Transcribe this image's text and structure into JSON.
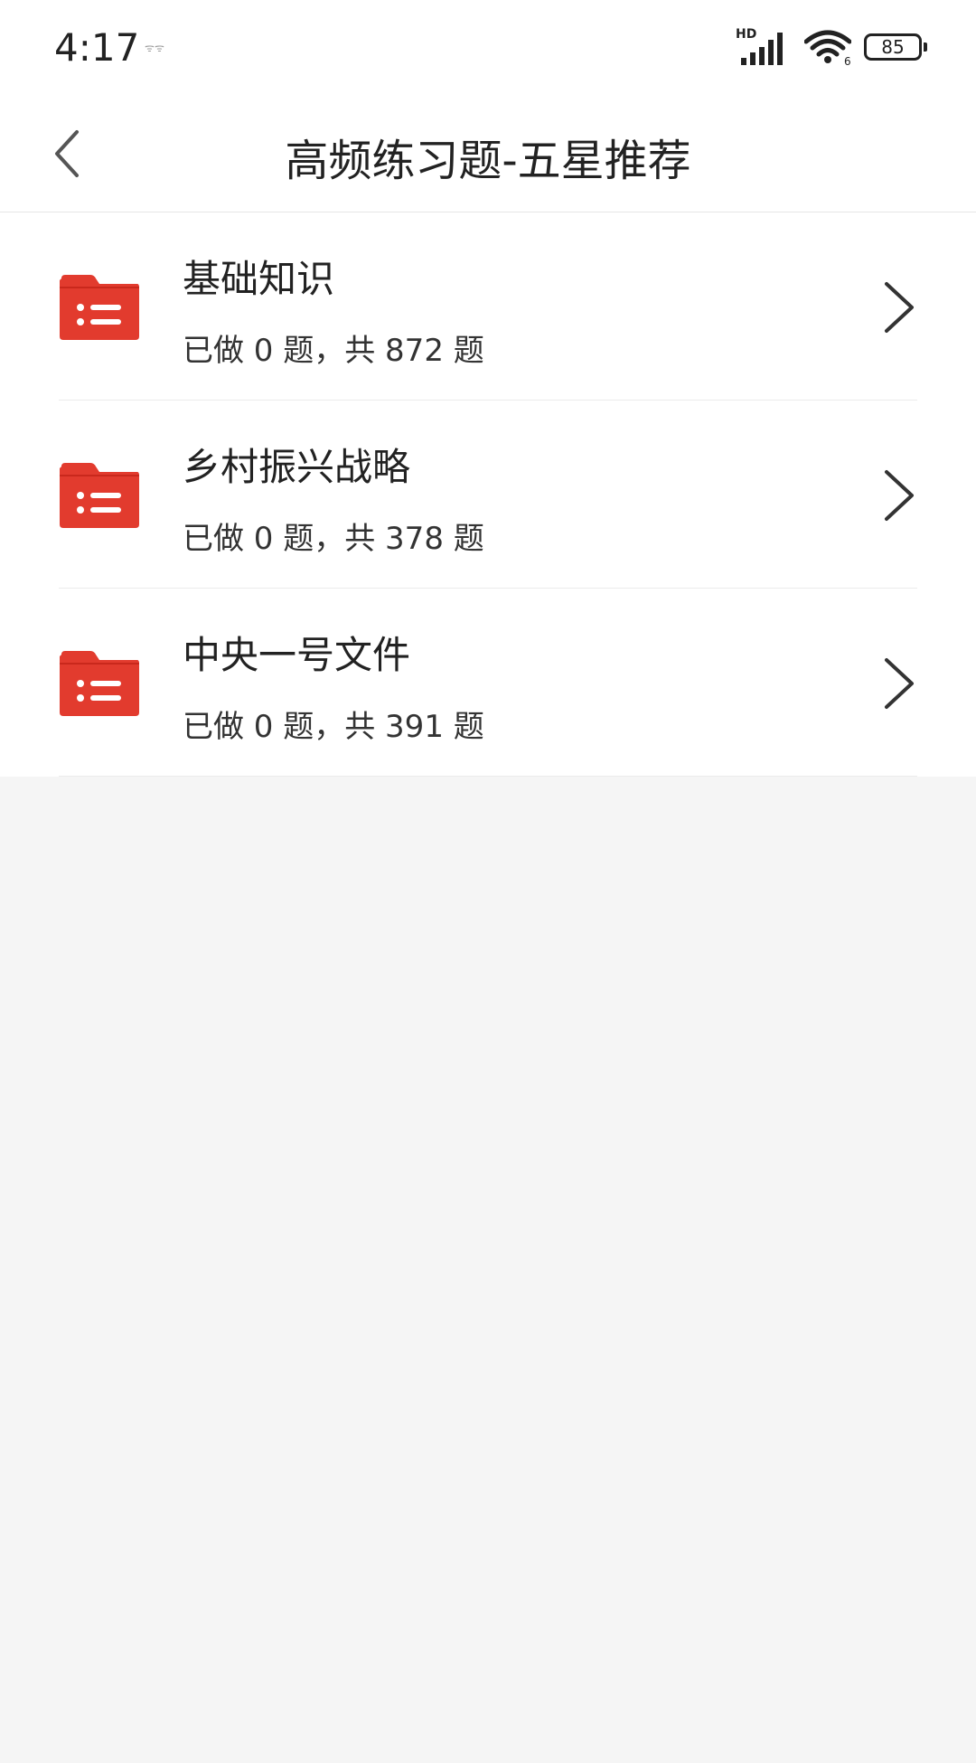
{
  "status_bar": {
    "time": "4:17",
    "notification_text": "ᯤᯤ",
    "network_label": "HD",
    "battery": "85"
  },
  "header": {
    "title": "高频练习题-五星推荐"
  },
  "categories": [
    {
      "title": "基础知识",
      "progress_text": "已做 0 题，共 872 题"
    },
    {
      "title": "乡村振兴战略",
      "progress_text": "已做 0 题，共 378 题"
    },
    {
      "title": "中央一号文件",
      "progress_text": "已做 0 题，共 391 题"
    }
  ],
  "colors": {
    "folder_red": "#e23b2e",
    "background": "#f5f5f5"
  },
  "icons": {
    "back": "back-arrow-icon",
    "folder": "folder-list-icon",
    "chevron": "chevron-right-icon",
    "signal": "cellular-signal-icon",
    "wifi": "wifi-icon",
    "battery": "battery-icon"
  }
}
